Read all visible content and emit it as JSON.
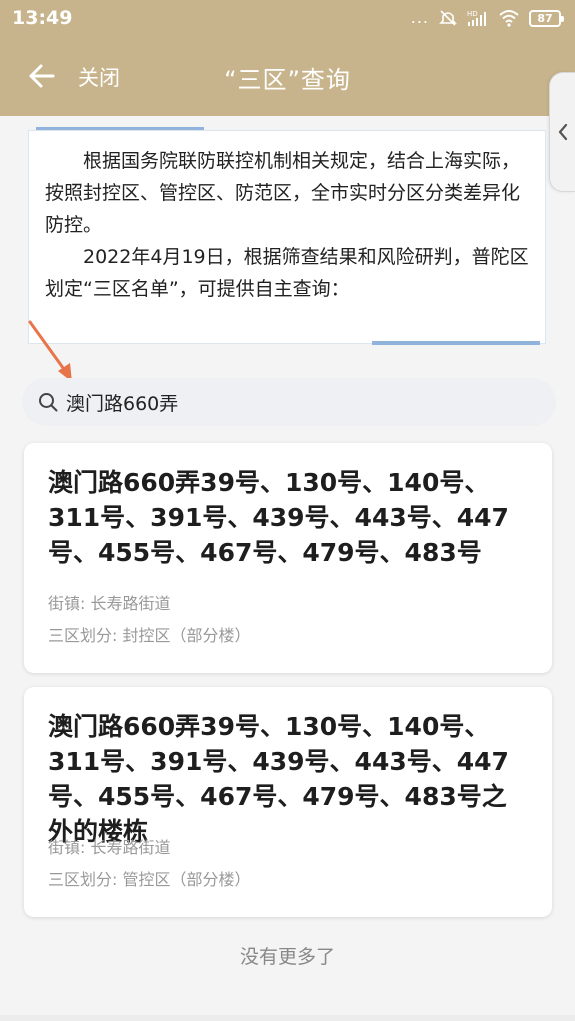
{
  "statusbar": {
    "time": "13:49",
    "dots": "...",
    "battery": "87"
  },
  "navbar": {
    "close_label": "关闭",
    "title": "“三区”查询"
  },
  "notice": {
    "paragraph1": "根据国务院联防联控机制相关规定，结合上海实际，按照封控区、管控区、防范区，全市实时分区分类差异化防控。",
    "paragraph2": "2022年4月19日，根据筛查结果和风险研判，普陀区划定“三区名单”，可提供自主查询："
  },
  "search": {
    "value": "澳门路660弄"
  },
  "results": [
    {
      "title": "澳门路660弄39号、130号、140号、311号、391号、439号、443号、447号、455号、467号、479号、483号",
      "street": "街镇: 长寿路街道",
      "zone": "三区划分: 封控区（部分楼）"
    },
    {
      "title": "澳门路660弄39号、130号、140号、311号、391号、439号、443号、447号、455号、467号、479号、483号之外的楼栋",
      "street": "街镇: 长寿路街道",
      "zone": "三区划分: 管控区（部分楼）"
    }
  ],
  "footer": {
    "no_more": "没有更多了"
  },
  "colors": {
    "header": "#c8b48c",
    "accent_line": "#8fb3da",
    "arrow": "#e8744a"
  },
  "icons": {
    "back": "arrow-left-icon",
    "search": "search-icon",
    "side_tab": "chevron-left-icon"
  }
}
